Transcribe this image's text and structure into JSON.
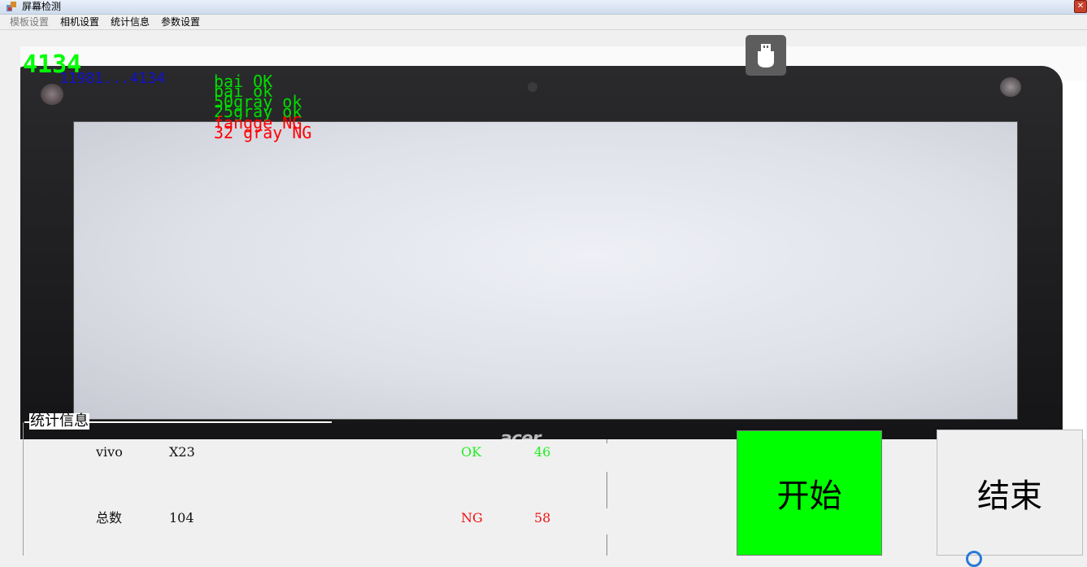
{
  "window": {
    "title": "屏幕检测",
    "close_glyph": "✕"
  },
  "menu": {
    "items": [
      {
        "label": "模板设置",
        "disabled": true
      },
      {
        "label": "相机设置",
        "disabled": false
      },
      {
        "label": "统计信息",
        "disabled": false
      },
      {
        "label": "参数设置",
        "disabled": false
      }
    ]
  },
  "camera_view": {
    "count": "4134",
    "serial": "11981...4134",
    "brand": "acer",
    "results": [
      {
        "text": "bai OK",
        "status": "ok"
      },
      {
        "text": "bai ok",
        "status": "ok"
      },
      {
        "text": "50gray ok",
        "status": "ok"
      },
      {
        "text": "25gray ok",
        "status": "ok"
      },
      {
        "text": "fangge NG",
        "status": "ng"
      },
      {
        "text": "32 gray NG",
        "status": "ng"
      }
    ],
    "colors": {
      "ok": "#00dd00",
      "ng": "#ff0000",
      "count": "#00ff00",
      "serial": "#1010d0"
    }
  },
  "usb_button": {
    "icon": "usb-drive-icon"
  },
  "stats": {
    "group_title": "统计信息",
    "brand": "vivo",
    "model": "X23",
    "total_label": "总数",
    "total": "104",
    "ok_label": "OK",
    "ok_count": "46",
    "ng_label": "NG",
    "ng_count": "58",
    "colors": {
      "ok": "#22ee22",
      "ng": "#ee1111"
    }
  },
  "actions": {
    "start_label": "开始",
    "end_label": "结束",
    "start_color": "#00ff00"
  }
}
